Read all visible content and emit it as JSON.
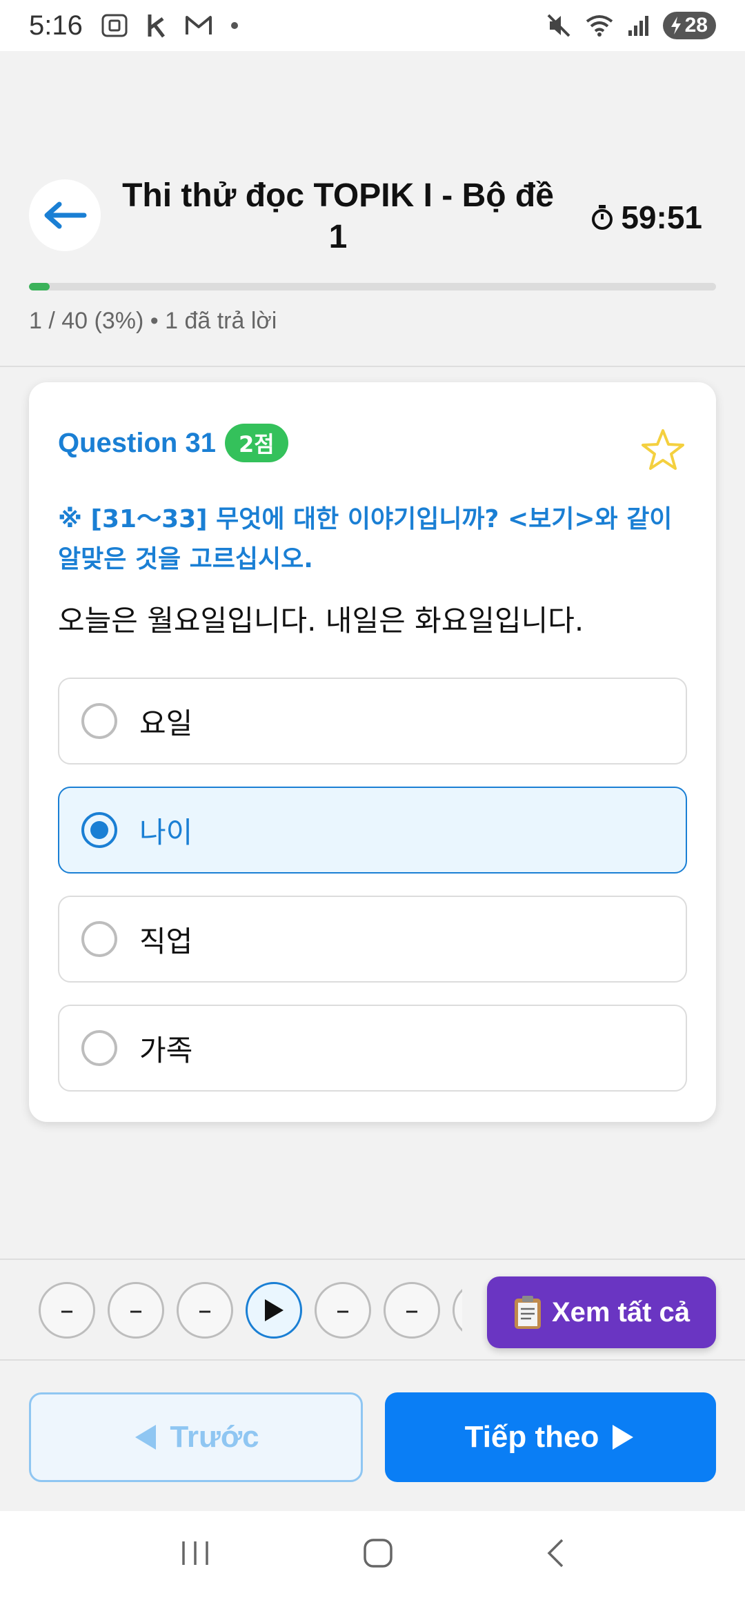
{
  "status_bar": {
    "time": "5:16",
    "battery": "28"
  },
  "header": {
    "title": "Thi thử đọc TOPIK I - Bộ đề 1",
    "timer": "59:51",
    "progress_fraction": 0.03,
    "progress_text": "1 / 40 (3%) • 1 đã trả lời"
  },
  "question": {
    "label": "Question 31",
    "points": "2점",
    "instruction": "※ [31～33] 무엇에 대한 이야기입니까? <보기>와 같이 알맞은 것을 고르십시오.",
    "text": "오늘은 월요일입니다. 내일은 화요일입니다.",
    "options": [
      {
        "label": "요일",
        "selected": false
      },
      {
        "label": "나이",
        "selected": true
      },
      {
        "label": "직업",
        "selected": false
      },
      {
        "label": "가족",
        "selected": false
      }
    ]
  },
  "question_nav": {
    "items": [
      "–",
      "–",
      "–",
      "▶",
      "–",
      "–"
    ],
    "view_all_label": "Xem tất cả"
  },
  "footer": {
    "prev_label": "Trước",
    "next_label": "Tiếp theo"
  },
  "colors": {
    "accent": "#1a7fd4",
    "progress": "#3bb25a",
    "badge": "#34c15b",
    "view_all": "#6a35c2",
    "next_button": "#0a7ef5",
    "star": "#f4d03f"
  }
}
